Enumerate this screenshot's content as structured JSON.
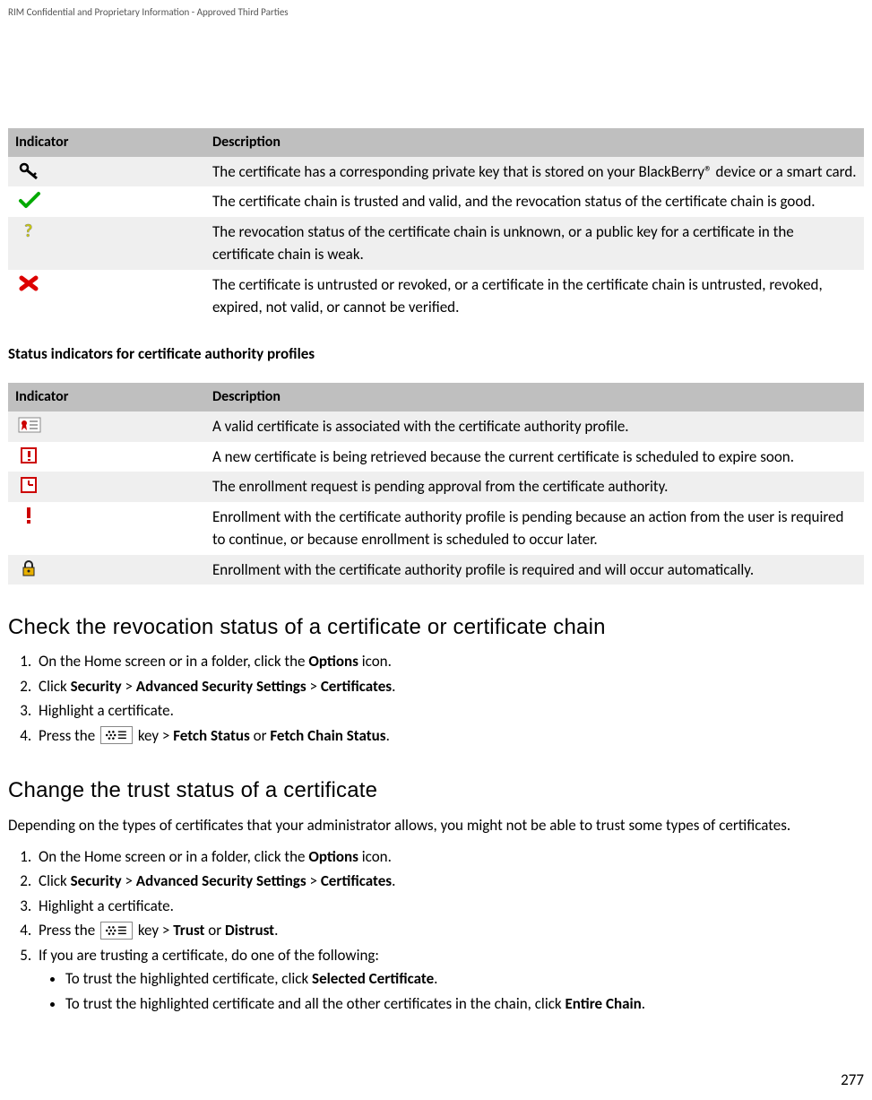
{
  "header": {
    "confidentiality": "RIM Confidential and Proprietary Information - Approved Third Parties"
  },
  "footer": {
    "page_number": "277"
  },
  "table1": {
    "col1": "Indicator",
    "col2": "Description",
    "rows": [
      {
        "icon": "key-icon",
        "desc": "The certificate has a corresponding private key that is stored on your BlackBerry® device or a smart card."
      },
      {
        "icon": "check-icon",
        "desc": "The certificate chain is trusted and valid, and the revocation status of the certificate chain is good."
      },
      {
        "icon": "question-icon",
        "desc": "The revocation status of the certificate chain is unknown, or a public key for a certificate in the certificate chain is weak."
      },
      {
        "icon": "x-icon",
        "desc": "The certificate is untrusted or revoked, or a certificate in the certificate chain is untrusted, revoked, expired, not valid, or cannot be verified."
      }
    ]
  },
  "subheading1": "Status indicators for certificate authority profiles",
  "table2": {
    "col1": "Indicator",
    "col2": "Description",
    "rows": [
      {
        "icon": "cert-valid-icon",
        "desc": "A valid certificate is associated with the certificate authority profile."
      },
      {
        "icon": "cert-alert-icon",
        "desc": "A new certificate is being retrieved because the current certificate is scheduled to expire soon."
      },
      {
        "icon": "cert-clock-icon",
        "desc": "The enrollment request is pending approval from the certificate authority."
      },
      {
        "icon": "exclaim-icon",
        "desc": "Enrollment with the certificate authority profile is pending because an action from the user is required to continue, or because enrollment is scheduled to occur later."
      },
      {
        "icon": "lock-icon",
        "desc": "Enrollment with the certificate authority profile is required and will occur automatically."
      }
    ]
  },
  "section1": {
    "title": "Check the revocation status of a certificate or certificate chain",
    "steps": {
      "s1": {
        "pre": "On the Home screen or in a folder, click the ",
        "bold": "Options",
        "post": " icon."
      },
      "s2": {
        "t0": "Click ",
        "b0": "Security",
        "t1": " > ",
        "b1": "Advanced Security Settings",
        "t2": " > ",
        "b2": "Certificates",
        "t3": "."
      },
      "s3": "Highlight a certificate.",
      "s4": {
        "t0": "Press the ",
        "t1": " key > ",
        "b0": "Fetch Status",
        "t2": " or ",
        "b1": "Fetch Chain Status",
        "t3": "."
      }
    }
  },
  "section2": {
    "title": "Change the trust status of a certificate",
    "intro": "Depending on the types of certificates that your administrator allows, you might not be able to trust some types of certificates.",
    "steps": {
      "s1": {
        "pre": "On the Home screen or in a folder, click the ",
        "bold": "Options",
        "post": " icon."
      },
      "s2": {
        "t0": "Click ",
        "b0": "Security",
        "t1": " > ",
        "b1": "Advanced Security Settings",
        "t2": " > ",
        "b2": "Certificates",
        "t3": "."
      },
      "s3": "Highlight a certificate.",
      "s4": {
        "t0": "Press the ",
        "t1": " key > ",
        "b0": "Trust",
        "t2": " or ",
        "b1": "Distrust",
        "t3": "."
      },
      "s5": "If you are trusting a certificate, do one of the following:",
      "s5sub": {
        "a": {
          "t0": "To trust the highlighted certificate, click ",
          "b0": "Selected Certificate",
          "t1": "."
        },
        "b": {
          "t0": "To trust the highlighted certificate and all the other certificates in the chain, click ",
          "b0": "Entire Chain",
          "t1": "."
        }
      }
    }
  }
}
